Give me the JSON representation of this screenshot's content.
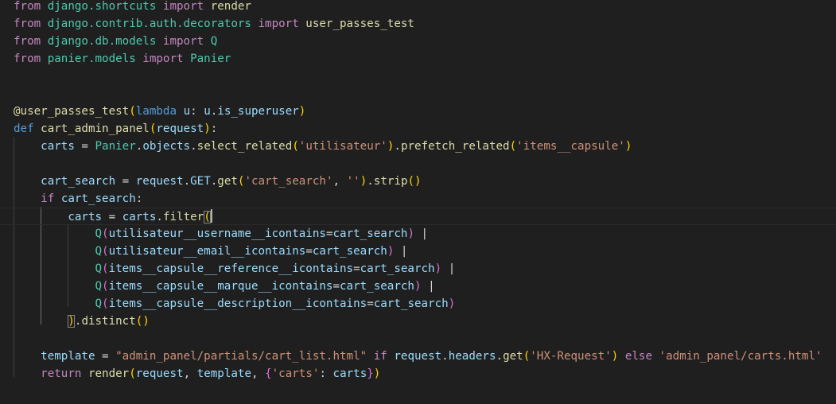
{
  "editor": {
    "language": "python",
    "lines": [
      {
        "tokens": [
          {
            "t": "from",
            "c": "kw"
          },
          {
            "t": " django.shortcuts ",
            "c": "mod"
          },
          {
            "t": "import",
            "c": "kw"
          },
          {
            "t": " render",
            "c": "fn"
          }
        ]
      },
      {
        "tokens": [
          {
            "t": "from",
            "c": "kw"
          },
          {
            "t": " django.contrib.auth.decorators ",
            "c": "mod"
          },
          {
            "t": "import",
            "c": "kw"
          },
          {
            "t": " user_passes_test",
            "c": "fn"
          }
        ]
      },
      {
        "tokens": [
          {
            "t": "from",
            "c": "kw"
          },
          {
            "t": " django.db.models ",
            "c": "mod"
          },
          {
            "t": "import",
            "c": "kw"
          },
          {
            "t": " Q",
            "c": "mod"
          }
        ]
      },
      {
        "tokens": [
          {
            "t": "from",
            "c": "kw"
          },
          {
            "t": " panier.models ",
            "c": "mod"
          },
          {
            "t": "import",
            "c": "kw"
          },
          {
            "t": " Panier",
            "c": "mod"
          }
        ]
      },
      {
        "tokens": []
      },
      {
        "tokens": []
      },
      {
        "tokens": [
          {
            "t": "@user_passes_test",
            "c": "dec"
          },
          {
            "t": "(",
            "c": "p1"
          },
          {
            "t": "lambda",
            "c": "def"
          },
          {
            "t": " ",
            "c": "plain"
          },
          {
            "t": "u",
            "c": "var"
          },
          {
            "t": ": ",
            "c": "plain"
          },
          {
            "t": "u",
            "c": "var"
          },
          {
            "t": ".",
            "c": "plain"
          },
          {
            "t": "is_superuser",
            "c": "var"
          },
          {
            "t": ")",
            "c": "p1"
          }
        ]
      },
      {
        "tokens": [
          {
            "t": "def",
            "c": "def"
          },
          {
            "t": " ",
            "c": "plain"
          },
          {
            "t": "cart_admin_panel",
            "c": "fn"
          },
          {
            "t": "(",
            "c": "p1"
          },
          {
            "t": "request",
            "c": "var"
          },
          {
            "t": ")",
            "c": "p1"
          },
          {
            "t": ":",
            "c": "plain"
          }
        ]
      },
      {
        "tokens": [
          {
            "t": "    ",
            "c": "plain"
          },
          {
            "t": "carts",
            "c": "var"
          },
          {
            "t": " = ",
            "c": "plain"
          },
          {
            "t": "Panier",
            "c": "mod"
          },
          {
            "t": ".",
            "c": "plain"
          },
          {
            "t": "objects",
            "c": "var"
          },
          {
            "t": ".",
            "c": "plain"
          },
          {
            "t": "select_related",
            "c": "fn"
          },
          {
            "t": "(",
            "c": "p1"
          },
          {
            "t": "'utilisateur'",
            "c": "str"
          },
          {
            "t": ")",
            "c": "p1"
          },
          {
            "t": ".",
            "c": "plain"
          },
          {
            "t": "prefetch_related",
            "c": "fn"
          },
          {
            "t": "(",
            "c": "p1"
          },
          {
            "t": "'items__capsule'",
            "c": "str"
          },
          {
            "t": ")",
            "c": "p1"
          }
        ]
      },
      {
        "tokens": []
      },
      {
        "tokens": [
          {
            "t": "    ",
            "c": "plain"
          },
          {
            "t": "cart_search",
            "c": "var"
          },
          {
            "t": " = ",
            "c": "plain"
          },
          {
            "t": "request",
            "c": "var"
          },
          {
            "t": ".",
            "c": "plain"
          },
          {
            "t": "GET",
            "c": "var"
          },
          {
            "t": ".",
            "c": "plain"
          },
          {
            "t": "get",
            "c": "fn"
          },
          {
            "t": "(",
            "c": "p1"
          },
          {
            "t": "'cart_search'",
            "c": "str"
          },
          {
            "t": ", ",
            "c": "plain"
          },
          {
            "t": "''",
            "c": "str"
          },
          {
            "t": ")",
            "c": "p1"
          },
          {
            "t": ".",
            "c": "plain"
          },
          {
            "t": "strip",
            "c": "fn"
          },
          {
            "t": "()",
            "c": "p1"
          }
        ]
      },
      {
        "tokens": [
          {
            "t": "    ",
            "c": "plain"
          },
          {
            "t": "if",
            "c": "kw"
          },
          {
            "t": " ",
            "c": "plain"
          },
          {
            "t": "cart_search",
            "c": "var"
          },
          {
            "t": ":",
            "c": "plain"
          }
        ]
      },
      {
        "active": true,
        "tokens": [
          {
            "t": "        ",
            "c": "plain"
          },
          {
            "t": "carts",
            "c": "var"
          },
          {
            "t": " = ",
            "c": "plain"
          },
          {
            "t": "carts",
            "c": "var"
          },
          {
            "t": ".",
            "c": "plain"
          },
          {
            "t": "filter",
            "c": "fn"
          },
          {
            "t": "(",
            "c": "p1",
            "match": true
          },
          {
            "cursor": true
          }
        ]
      },
      {
        "tokens": [
          {
            "t": "            ",
            "c": "plain"
          },
          {
            "t": "Q",
            "c": "mod"
          },
          {
            "t": "(",
            "c": "p2"
          },
          {
            "t": "utilisateur__username__icontains",
            "c": "var"
          },
          {
            "t": "=",
            "c": "plain"
          },
          {
            "t": "cart_search",
            "c": "var"
          },
          {
            "t": ")",
            "c": "p2"
          },
          {
            "t": " |",
            "c": "plain"
          }
        ]
      },
      {
        "tokens": [
          {
            "t": "            ",
            "c": "plain"
          },
          {
            "t": "Q",
            "c": "mod"
          },
          {
            "t": "(",
            "c": "p2"
          },
          {
            "t": "utilisateur__email__icontains",
            "c": "var"
          },
          {
            "t": "=",
            "c": "plain"
          },
          {
            "t": "cart_search",
            "c": "var"
          },
          {
            "t": ")",
            "c": "p2"
          },
          {
            "t": " |",
            "c": "plain"
          }
        ]
      },
      {
        "tokens": [
          {
            "t": "            ",
            "c": "plain"
          },
          {
            "t": "Q",
            "c": "mod"
          },
          {
            "t": "(",
            "c": "p2"
          },
          {
            "t": "items__capsule__reference__icontains",
            "c": "var"
          },
          {
            "t": "=",
            "c": "plain"
          },
          {
            "t": "cart_search",
            "c": "var"
          },
          {
            "t": ")",
            "c": "p2"
          },
          {
            "t": " |",
            "c": "plain"
          }
        ]
      },
      {
        "tokens": [
          {
            "t": "            ",
            "c": "plain"
          },
          {
            "t": "Q",
            "c": "mod"
          },
          {
            "t": "(",
            "c": "p2"
          },
          {
            "t": "items__capsule__marque__icontains",
            "c": "var"
          },
          {
            "t": "=",
            "c": "plain"
          },
          {
            "t": "cart_search",
            "c": "var"
          },
          {
            "t": ")",
            "c": "p2"
          },
          {
            "t": " |",
            "c": "plain"
          }
        ]
      },
      {
        "tokens": [
          {
            "t": "            ",
            "c": "plain"
          },
          {
            "t": "Q",
            "c": "mod"
          },
          {
            "t": "(",
            "c": "p2"
          },
          {
            "t": "items__capsule__description__icontains",
            "c": "var"
          },
          {
            "t": "=",
            "c": "plain"
          },
          {
            "t": "cart_search",
            "c": "var"
          },
          {
            "t": ")",
            "c": "p2"
          }
        ]
      },
      {
        "tokens": [
          {
            "t": "        ",
            "c": "plain"
          },
          {
            "t": ")",
            "c": "p1",
            "match": true
          },
          {
            "t": ".",
            "c": "plain"
          },
          {
            "t": "distinct",
            "c": "fn"
          },
          {
            "t": "()",
            "c": "p1"
          }
        ]
      },
      {
        "tokens": []
      },
      {
        "tokens": [
          {
            "t": "    ",
            "c": "plain"
          },
          {
            "t": "template",
            "c": "var"
          },
          {
            "t": " = ",
            "c": "plain"
          },
          {
            "t": "\"admin_panel/partials/cart_list.html\"",
            "c": "str"
          },
          {
            "t": " ",
            "c": "plain"
          },
          {
            "t": "if",
            "c": "kw"
          },
          {
            "t": " ",
            "c": "plain"
          },
          {
            "t": "request",
            "c": "var"
          },
          {
            "t": ".",
            "c": "plain"
          },
          {
            "t": "headers",
            "c": "var"
          },
          {
            "t": ".",
            "c": "plain"
          },
          {
            "t": "get",
            "c": "fn"
          },
          {
            "t": "(",
            "c": "p1"
          },
          {
            "t": "'HX-Request'",
            "c": "str"
          },
          {
            "t": ")",
            "c": "p1"
          },
          {
            "t": " ",
            "c": "plain"
          },
          {
            "t": "else",
            "c": "kw"
          },
          {
            "t": " ",
            "c": "plain"
          },
          {
            "t": "'admin_panel/carts.html'",
            "c": "str"
          }
        ]
      },
      {
        "tokens": [
          {
            "t": "    ",
            "c": "plain"
          },
          {
            "t": "return",
            "c": "kw"
          },
          {
            "t": " ",
            "c": "plain"
          },
          {
            "t": "render",
            "c": "fn"
          },
          {
            "t": "(",
            "c": "p1"
          },
          {
            "t": "request",
            "c": "var"
          },
          {
            "t": ", ",
            "c": "plain"
          },
          {
            "t": "template",
            "c": "var"
          },
          {
            "t": ", ",
            "c": "plain"
          },
          {
            "t": "{",
            "c": "p2"
          },
          {
            "t": "'carts'",
            "c": "str"
          },
          {
            "t": ": ",
            "c": "plain"
          },
          {
            "t": "carts",
            "c": "var"
          },
          {
            "t": "}",
            "c": "p2"
          },
          {
            "t": ")",
            "c": "p1"
          }
        ]
      }
    ]
  }
}
